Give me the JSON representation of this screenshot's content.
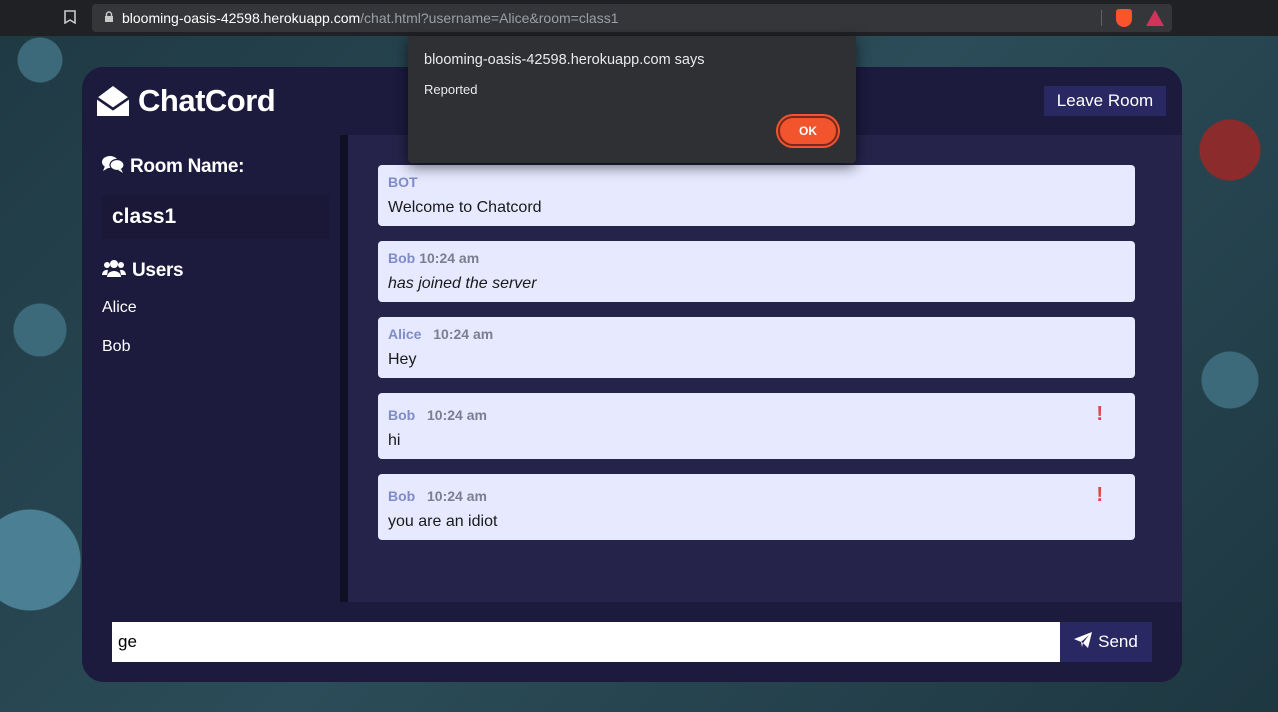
{
  "browser": {
    "url_domain": "blooming-oasis-42598.herokuapp.com",
    "url_path": "/chat.html?username=Alice&room=class1"
  },
  "app": {
    "title": "ChatCord",
    "leave_label": "Leave Room"
  },
  "sidebar": {
    "room_heading": "Room Name:",
    "room_name": "class1",
    "users_heading": "Users",
    "users": [
      "Alice",
      "Bob"
    ]
  },
  "messages": [
    {
      "user": "BOT",
      "time": "",
      "text": "Welcome to Chatcord",
      "italic": false,
      "reported": false
    },
    {
      "user": "Bob",
      "time": "10:24 am",
      "text": "has joined the server",
      "italic": true,
      "reported": false
    },
    {
      "user": "Alice",
      "time": "10:24 am",
      "text": "Hey",
      "italic": false,
      "reported": false
    },
    {
      "user": "Bob",
      "time": "10:24 am",
      "text": "hi",
      "italic": false,
      "reported": true
    },
    {
      "user": "Bob",
      "time": "10:24 am",
      "text": "you are an idiot",
      "italic": false,
      "reported": true
    }
  ],
  "form": {
    "input_value": "ge",
    "send_label": "Send"
  },
  "alert": {
    "title": "blooming-oasis-42598.herokuapp.com says",
    "message": "Reported",
    "ok_label": "OK"
  },
  "colors": {
    "header_bg": "#1c1a3d",
    "button_bg": "#2a2862",
    "message_bg": "#e6e9ff",
    "ok_button": "#f2542d",
    "report_icon": "#e0454a"
  }
}
